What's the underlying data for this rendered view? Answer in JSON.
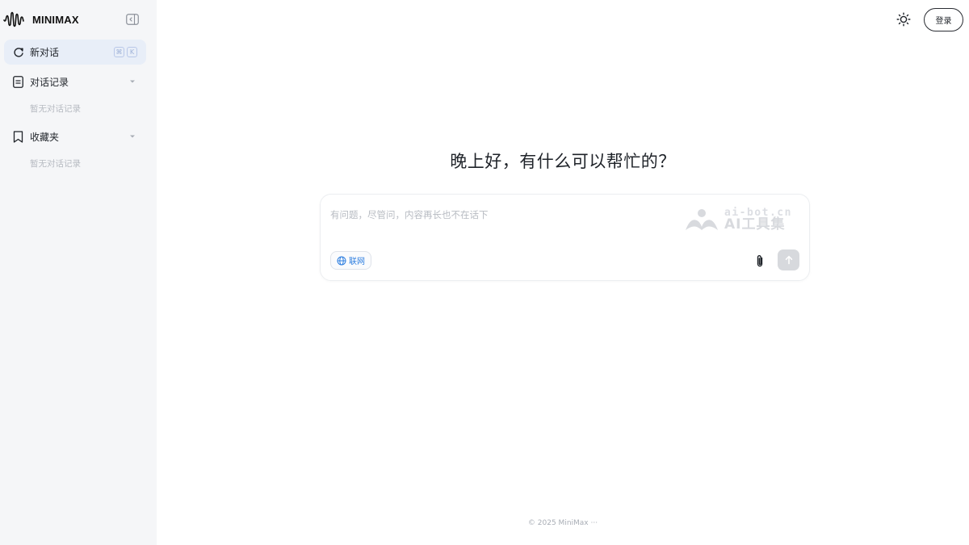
{
  "brand": {
    "name": "MINIMAX"
  },
  "sidebar": {
    "new_chat": {
      "label": "新对话",
      "shortcut": [
        "⌘",
        "K"
      ]
    },
    "history": {
      "label": "对话记录",
      "empty": "暂无对话记录"
    },
    "favorites": {
      "label": "收藏夹",
      "empty": "暂无对话记录"
    }
  },
  "header": {
    "login_label": "登录"
  },
  "main": {
    "greeting": "晚上好，有什么可以帮忙的？",
    "input": {
      "placeholder": "有问题，尽管问，内容再长也不在话下",
      "web_toggle_label": "联网"
    },
    "watermark": {
      "top": "ai-bot.cn",
      "bottom": "AI工具集"
    }
  },
  "footer": {
    "text": "© 2025 MiniMax ···"
  },
  "icons": {
    "logo": "waveform-logo-icon",
    "collapse": "sidebar-collapse-icon",
    "new_chat": "refresh-chat-icon",
    "history": "document-icon",
    "favorites": "bookmark-icon",
    "chevron": "chevron-down-icon",
    "theme": "sun-icon",
    "web": "globe-icon",
    "attach": "paperclip-icon",
    "send": "arrow-up-icon"
  },
  "colors": {
    "sidebar_bg": "#f5f6f8",
    "active_item_bg": "#e8eef8",
    "web_toggle_text": "#2f7fe0",
    "send_disabled": "#d7d9dd"
  }
}
